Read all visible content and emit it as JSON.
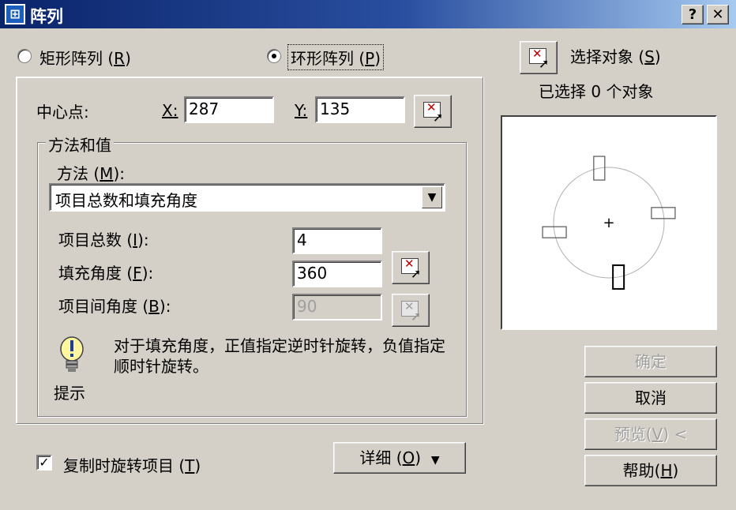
{
  "window": {
    "title": "阵列",
    "app_icon": "autocad-icon",
    "help_button": "?",
    "close_button": "✕"
  },
  "mode": {
    "rect_label": "矩形阵列",
    "rect_key": "R",
    "polar_label": "环形阵列",
    "polar_key": "P",
    "selected": "polar"
  },
  "center": {
    "label": "中心点:",
    "x_label": "X:",
    "x_value": "287",
    "y_label": "Y:",
    "y_value": "135"
  },
  "method_group": {
    "title": "方法和值",
    "method_label": "方法",
    "method_key": "M",
    "method_value": "项目总数和填充角度",
    "total_items_label": "项目总数",
    "total_items_key": "I",
    "total_items_value": "4",
    "fill_angle_label": "填充角度",
    "fill_angle_key": "F",
    "fill_angle_value": "360",
    "between_angle_label": "项目间角度",
    "between_angle_key": "B",
    "between_angle_value": "90",
    "tip_text": "对于填充角度，正值指定逆时针旋转，负值指定顺时针旋转。",
    "tip_label": "提示"
  },
  "rotate": {
    "label": "复制时旋转项目",
    "key": "T",
    "checked": true
  },
  "details_button": {
    "label": "详细",
    "key": "O",
    "arrow": "▼"
  },
  "selection": {
    "button_label": "选择对象",
    "button_key": "S",
    "status": "已选择 0 个对象"
  },
  "preview": {
    "item_count": 4,
    "fill_angle_deg": 360
  },
  "buttons": {
    "ok": "确定",
    "cancel": "取消",
    "preview": "预览",
    "preview_key": "V",
    "preview_arrow": "<",
    "help": "帮助",
    "help_key": "H"
  }
}
